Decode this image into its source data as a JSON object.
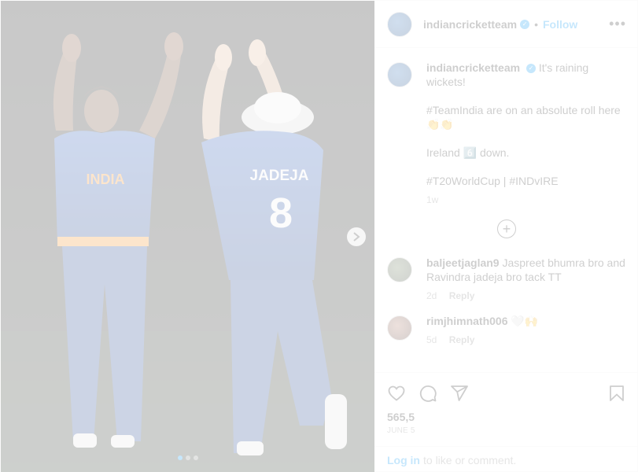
{
  "header": {
    "username": "indiancricketteam",
    "separator": "•",
    "follow_label": "Follow",
    "more_label": "•••"
  },
  "caption": {
    "username": "indiancricketteam",
    "lines": [
      "It's raining wickets!",
      "#TeamIndia are on an absolute roll here 👏👏",
      "Ireland 6️⃣ down.",
      "#T20WorldCup | #INDvIRE"
    ],
    "time": "1w"
  },
  "comments": [
    {
      "username": "baljeetjaglan9",
      "text": "Jaspreet bhumra bro and Ravindra jadeja bro tack TT",
      "time": "2d",
      "reply_label": "Reply"
    },
    {
      "username": "rimjhimnath006",
      "text": "🤍🙌",
      "time": "5d",
      "reply_label": "Reply"
    }
  ],
  "carousel": {
    "slides": 3,
    "active": 0
  },
  "likes": "565,5",
  "date": "June 5",
  "login": {
    "link": "Log in",
    "text": "to like or comment."
  },
  "photo": {
    "jersey_name": "JADEJA",
    "jersey_number": "8",
    "chest_text": "INDIA"
  },
  "colors": {
    "accent": "#0095f6",
    "jersey": "#1f4fb0",
    "background": "#ffffff"
  }
}
